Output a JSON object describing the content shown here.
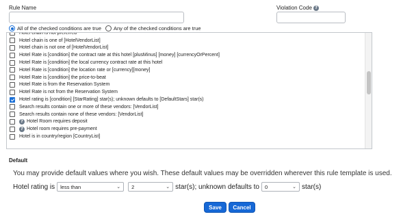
{
  "form": {
    "rule_name_label": "Rule Name",
    "rule_name_value": "",
    "violation_code_label": "Violation Code",
    "violation_code_value": ""
  },
  "match_mode": {
    "all_label": "All of the checked conditions are true",
    "any_label": "Any of the checked conditions are true",
    "selected": "all"
  },
  "conditions": [
    {
      "label": "Hotel chain is not preferred",
      "checked": false,
      "help": false
    },
    {
      "label": "Hotel chain is one of [HotelVendorList]",
      "checked": false,
      "help": false
    },
    {
      "label": "Hotel chain is not one of [HotelVendorList]",
      "checked": false,
      "help": false
    },
    {
      "label": "Hotel Rate is [condition] the contract rate at this hotel [plusMinus] [money] [currencyOrPercent]",
      "checked": false,
      "help": false
    },
    {
      "label": "Hotel Rate is [condition] the local currency contract rate at this hotel",
      "checked": false,
      "help": false
    },
    {
      "label": "Hotel Rate is [condition] the location rate or [currency][money]",
      "checked": false,
      "help": false
    },
    {
      "label": "Hotel Rate is [condition] the price-to-beat",
      "checked": false,
      "help": false
    },
    {
      "label": "Hotel Rate is from the Reservation System",
      "checked": false,
      "help": false
    },
    {
      "label": "Hotel Rate is not from the Reservation System",
      "checked": false,
      "help": false
    },
    {
      "label": "Hotel rating is [condition] [StarRating] star(s); unknown defaults to [DefaultStars] star(s)",
      "checked": true,
      "help": false
    },
    {
      "label": "Search results contain one or more of these vendors: [VendorList]",
      "checked": false,
      "help": false
    },
    {
      "label": "Search results contain none of these vendors: [VendorList]",
      "checked": false,
      "help": false
    },
    {
      "label": "Hotel Room requires deposit",
      "checked": false,
      "help": true
    },
    {
      "label": "Hotel room requires pre-payment",
      "checked": false,
      "help": true
    },
    {
      "label": "Hotel is in country/region [CountryList]",
      "checked": false,
      "help": false
    }
  ],
  "defaults": {
    "title": "Default",
    "info": "You may provide default values where you wish. These default values may be overridden wherever this rule template is used.",
    "prefix": "Hotel rating is",
    "condition_value": "less than",
    "stars_value": "2",
    "middle_text": "star(s); unknown defaults to",
    "default_stars_value": "0",
    "suffix": "star(s)"
  },
  "buttons": {
    "save": "Save",
    "cancel": "Cancel"
  },
  "colors": {
    "accent": "#1668d6"
  }
}
